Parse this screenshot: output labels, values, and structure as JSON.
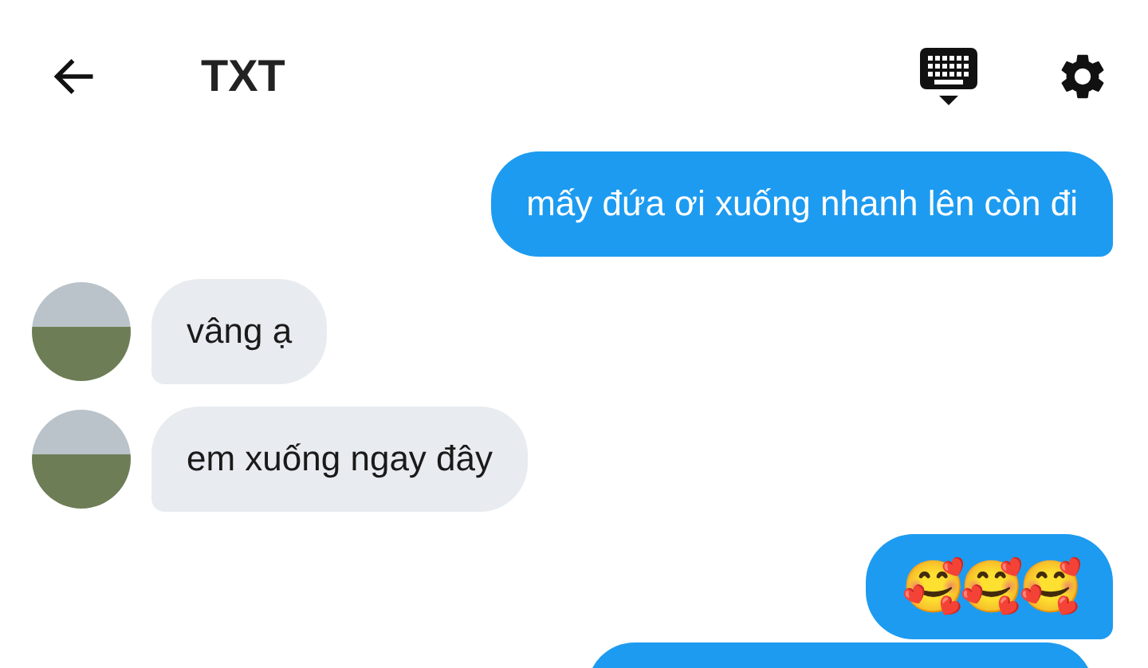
{
  "header": {
    "title": "TXT"
  },
  "messages": [
    {
      "outgoing": true,
      "kind": "text",
      "text": "mấy đứa ơi xuống nhanh lên còn đi"
    },
    {
      "outgoing": false,
      "kind": "text",
      "text": "vâng ạ"
    },
    {
      "outgoing": false,
      "kind": "text",
      "text": "em xuống ngay đây"
    },
    {
      "outgoing": true,
      "kind": "emoji",
      "text": "🥰🥰🥰"
    },
    {
      "outgoing": true,
      "kind": "cut"
    }
  ]
}
